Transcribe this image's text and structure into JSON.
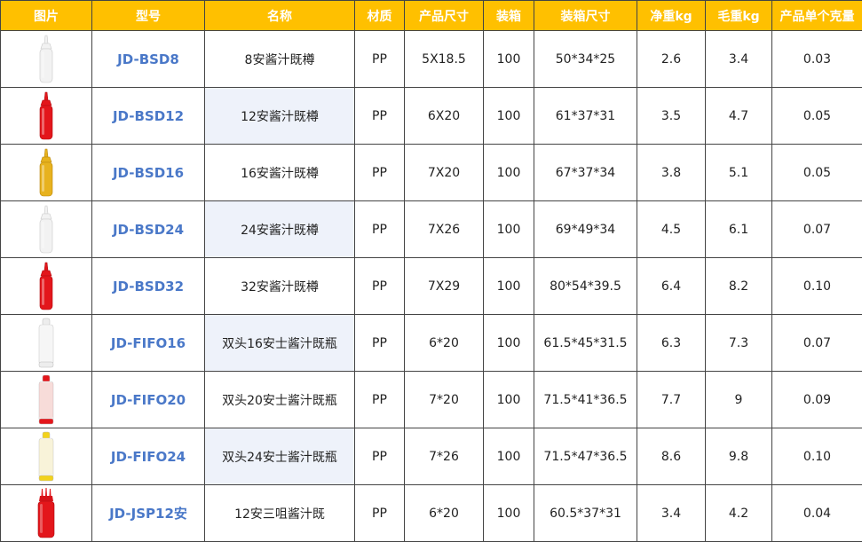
{
  "colors": {
    "header_bg": "#FFC000",
    "header_text": "#FFFFFF",
    "model_text": "#4A78C8",
    "alt_cell_bg": "#EEF2FA"
  },
  "headers": [
    "图片",
    "型号",
    "名称",
    "材质",
    "产品尺寸",
    "装箱",
    "装箱尺寸",
    "净重kg",
    "毛重kg",
    "产品单个克量"
  ],
  "rows": [
    {
      "image": "white-squeeze-bottle",
      "model": "JD-BSD8",
      "name": "8安酱汁既樽",
      "material": "PP",
      "size": "5X18.5",
      "pack": "100",
      "carton": "50*34*25",
      "net": "2.6",
      "gross": "3.4",
      "unit": "0.03"
    },
    {
      "image": "red-squeeze-bottle",
      "model": "JD-BSD12",
      "name": "12安酱汁既樽",
      "material": "PP",
      "size": "6X20",
      "pack": "100",
      "carton": "61*37*31",
      "net": "3.5",
      "gross": "4.7",
      "unit": "0.05"
    },
    {
      "image": "yellow-squeeze-bottle",
      "model": "JD-BSD16",
      "name": "16安酱汁既樽",
      "material": "PP",
      "size": "7X20",
      "pack": "100",
      "carton": "67*37*34",
      "net": "3.8",
      "gross": "5.1",
      "unit": "0.05"
    },
    {
      "image": "white-squeeze-bottle",
      "model": "JD-BSD24",
      "name": "24安酱汁既樽",
      "material": "PP",
      "size": "7X26",
      "pack": "100",
      "carton": "69*49*34",
      "net": "4.5",
      "gross": "6.1",
      "unit": "0.07"
    },
    {
      "image": "red-squeeze-bottle",
      "model": "JD-BSD32",
      "name": "32安酱汁既樽",
      "material": "PP",
      "size": "7X29",
      "pack": "100",
      "carton": "80*54*39.5",
      "net": "6.4",
      "gross": "8.2",
      "unit": "0.10"
    },
    {
      "image": "clear-fifo-bottle",
      "model": "JD-FIFO16",
      "name": "双头16安士酱汁既瓶",
      "material": "PP",
      "size": "6*20",
      "pack": "100",
      "carton": "61.5*45*31.5",
      "net": "6.3",
      "gross": "7.3",
      "unit": "0.07"
    },
    {
      "image": "red-cap-fifo-bottle",
      "model": "JD-FIFO20",
      "name": "双头20安士酱汁既瓶",
      "material": "PP",
      "size": "7*20",
      "pack": "100",
      "carton": "71.5*41*36.5",
      "net": "7.7",
      "gross": "9",
      "unit": "0.09"
    },
    {
      "image": "yellow-cap-fifo-bottle",
      "model": "JD-FIFO24",
      "name": "双头24安士酱汁既瓶",
      "material": "PP",
      "size": "7*26",
      "pack": "100",
      "carton": "71.5*47*36.5",
      "net": "8.6",
      "gross": "9.8",
      "unit": "0.10"
    },
    {
      "image": "triple-nozzle-red-bottle",
      "model": "JD-JSP12安",
      "name": "12安三咀酱汁既",
      "material": "PP",
      "size": "6*20",
      "pack": "100",
      "carton": "60.5*37*31",
      "net": "3.4",
      "gross": "4.2",
      "unit": "0.04"
    }
  ]
}
